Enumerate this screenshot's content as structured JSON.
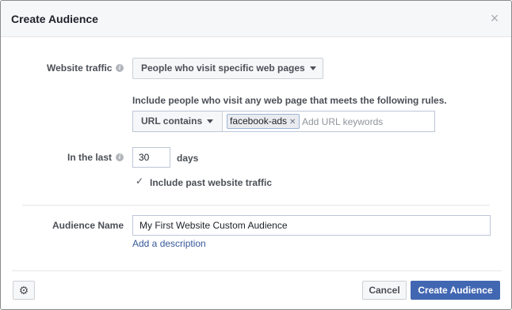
{
  "dialog": {
    "title": "Create Audience",
    "close_icon": "×"
  },
  "website_traffic": {
    "label": "Website traffic",
    "info_icon": "i",
    "dropdown_value": "People who visit specific web pages",
    "rule_description": "Include people who visit any web page that meets the following rules.",
    "rule_type": "URL contains",
    "keyword_tokens": [
      "facebook-ads"
    ],
    "keyword_placeholder": "Add URL keywords"
  },
  "retention": {
    "label": "In the last",
    "info_icon": "i",
    "value": "30",
    "unit": "days",
    "include_past_checked": true,
    "include_past_label": "Include past website traffic"
  },
  "audience_name": {
    "label": "Audience Name",
    "value": "My First Website Custom Audience",
    "add_description_link": "Add a description"
  },
  "footer": {
    "gear_icon": "⚙",
    "cancel_label": "Cancel",
    "create_label": "Create Audience"
  },
  "colors": {
    "primary": "#4267b2",
    "link": "#365899",
    "header_bg": "#f6f7f9",
    "label_text": "#4b4f56"
  }
}
